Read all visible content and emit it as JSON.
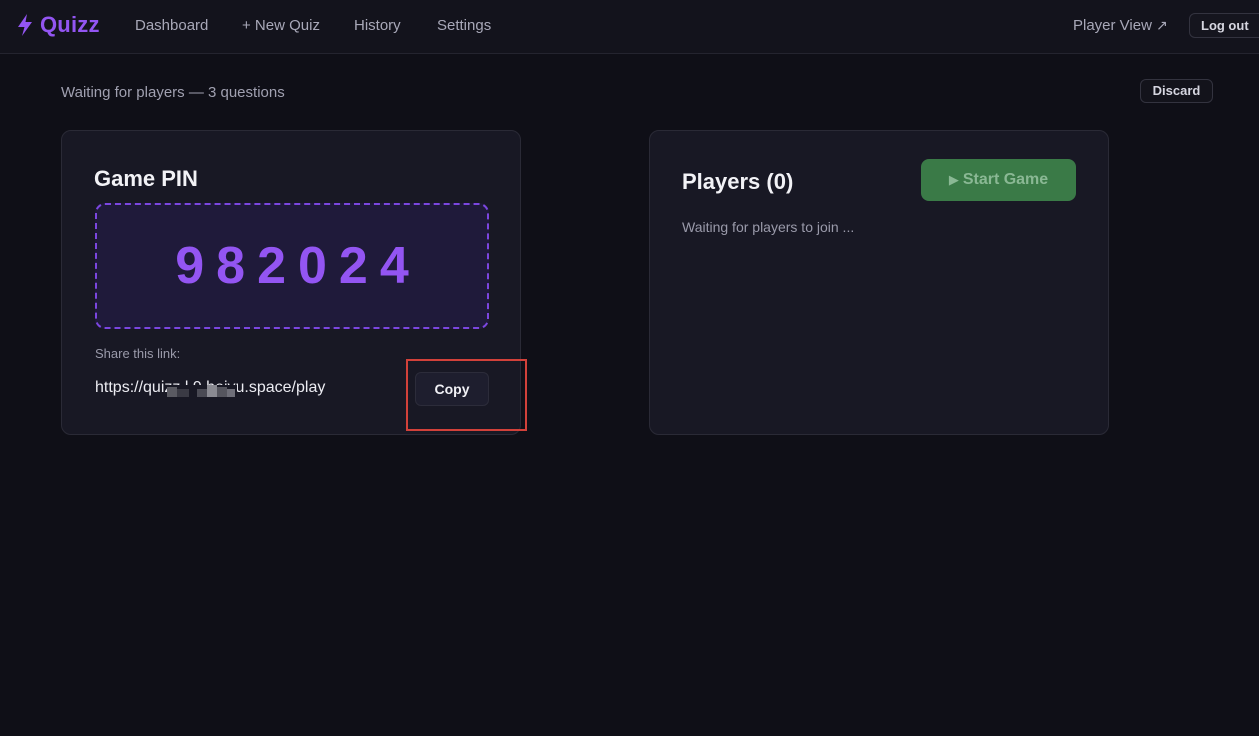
{
  "app": {
    "name": "Quizz",
    "accent_color": "#9355f2"
  },
  "nav": {
    "items": [
      {
        "label": "Dashboard"
      },
      {
        "label": "+ New Quiz"
      },
      {
        "label": "History"
      },
      {
        "label": "Settings"
      }
    ],
    "player_view_label": "Player View",
    "player_view_icon": "external-arrow-icon",
    "logout_label": "Log out"
  },
  "status": {
    "text": "Waiting for players — 3 questions",
    "discard_label": "Discard"
  },
  "game_pin_card": {
    "title": "Game PIN",
    "pin": "982024",
    "share_label": "Share this link:",
    "share_link": "https://quizz.l          9.heiyu.space/play",
    "copy_label": "Copy"
  },
  "players_card": {
    "title": "Players (0)",
    "start_label": "Start Game",
    "start_icon": "play-icon",
    "start_color": "#3a7a47",
    "waiting_text": "Waiting for players to join ..."
  }
}
